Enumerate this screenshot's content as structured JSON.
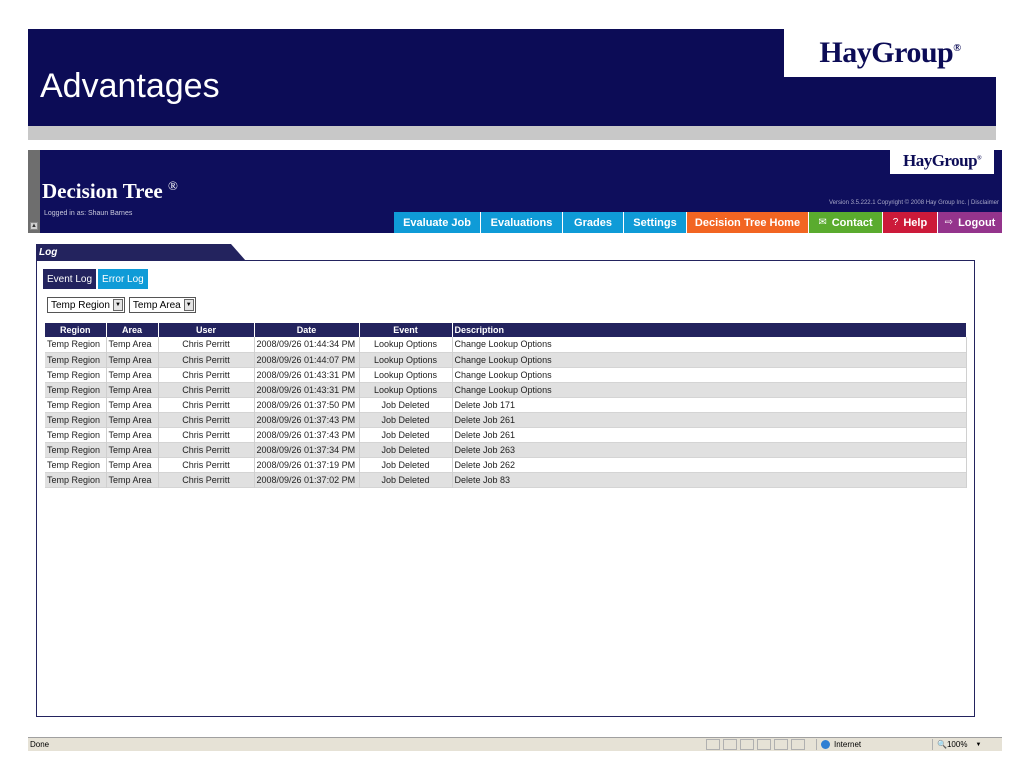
{
  "slide": {
    "title": "Advantages",
    "logo_text": "HayGroup",
    "logo_mark": "®"
  },
  "app": {
    "title": "Decision Tree",
    "title_mark": "®",
    "logo_text": "HayGroup",
    "logo_mark": "®",
    "logged_in": "Logged in as:  Shaun Barnes",
    "version": "Version 3.5.222.1 Copyright © 2008 Hay Group Inc. | Disclaimer",
    "nav": [
      {
        "label": "Evaluate Job",
        "color": "#0f9bd7"
      },
      {
        "label": "Evaluations",
        "color": "#0f9bd7"
      },
      {
        "label": "Grades",
        "color": "#0f9bd7"
      },
      {
        "label": "Settings",
        "color": "#0f9bd7"
      },
      {
        "label": "Decision Tree Home",
        "color": "#f26522"
      },
      {
        "label": "Contact",
        "color": "#5aab2e",
        "icon": "mail-icon"
      },
      {
        "label": "Help",
        "color": "#cc1a3a",
        "icon": "question-icon"
      },
      {
        "label": "Logout",
        "color": "#94348c",
        "icon": "logout-icon"
      }
    ]
  },
  "log": {
    "tab_label": "Log",
    "subtabs": {
      "event": "Event Log",
      "error": "Error Log"
    },
    "filters": {
      "region": "Temp Region",
      "area": "Temp Area"
    },
    "columns": [
      "Region",
      "Area",
      "User",
      "Date",
      "Event",
      "Description"
    ],
    "rows": [
      [
        "Temp Region",
        "Temp Area",
        "Chris Perritt",
        "2008/09/26 01:44:34 PM",
        "Lookup Options",
        "Change Lookup Options"
      ],
      [
        "Temp Region",
        "Temp Area",
        "Chris Perritt",
        "2008/09/26 01:44:07 PM",
        "Lookup Options",
        "Change Lookup Options"
      ],
      [
        "Temp Region",
        "Temp Area",
        "Chris Perritt",
        "2008/09/26 01:43:31 PM",
        "Lookup Options",
        "Change Lookup Options"
      ],
      [
        "Temp Region",
        "Temp Area",
        "Chris Perritt",
        "2008/09/26 01:43:31 PM",
        "Lookup Options",
        "Change Lookup Options"
      ],
      [
        "Temp Region",
        "Temp Area",
        "Chris Perritt",
        "2008/09/26 01:37:50 PM",
        "Job Deleted",
        "Delete Job 171"
      ],
      [
        "Temp Region",
        "Temp Area",
        "Chris Perritt",
        "2008/09/26 01:37:43 PM",
        "Job Deleted",
        "Delete Job 261"
      ],
      [
        "Temp Region",
        "Temp Area",
        "Chris Perritt",
        "2008/09/26 01:37:43 PM",
        "Job Deleted",
        "Delete Job 261"
      ],
      [
        "Temp Region",
        "Temp Area",
        "Chris Perritt",
        "2008/09/26 01:37:34 PM",
        "Job Deleted",
        "Delete Job 263"
      ],
      [
        "Temp Region",
        "Temp Area",
        "Chris Perritt",
        "2008/09/26 01:37:19 PM",
        "Job Deleted",
        "Delete Job 262"
      ],
      [
        "Temp Region",
        "Temp Area",
        "Chris Perritt",
        "2008/09/26 01:37:02 PM",
        "Job Deleted",
        "Delete Job 83"
      ]
    ]
  },
  "statusbar": {
    "left": "Done",
    "zone": "Internet",
    "zoom": "100%"
  },
  "colors": {
    "navy": "#0c0c56",
    "accent_blue": "#0f9bd7",
    "orange": "#f26522",
    "green": "#5aab2e",
    "red": "#cc1a3a",
    "purple": "#94348c"
  }
}
